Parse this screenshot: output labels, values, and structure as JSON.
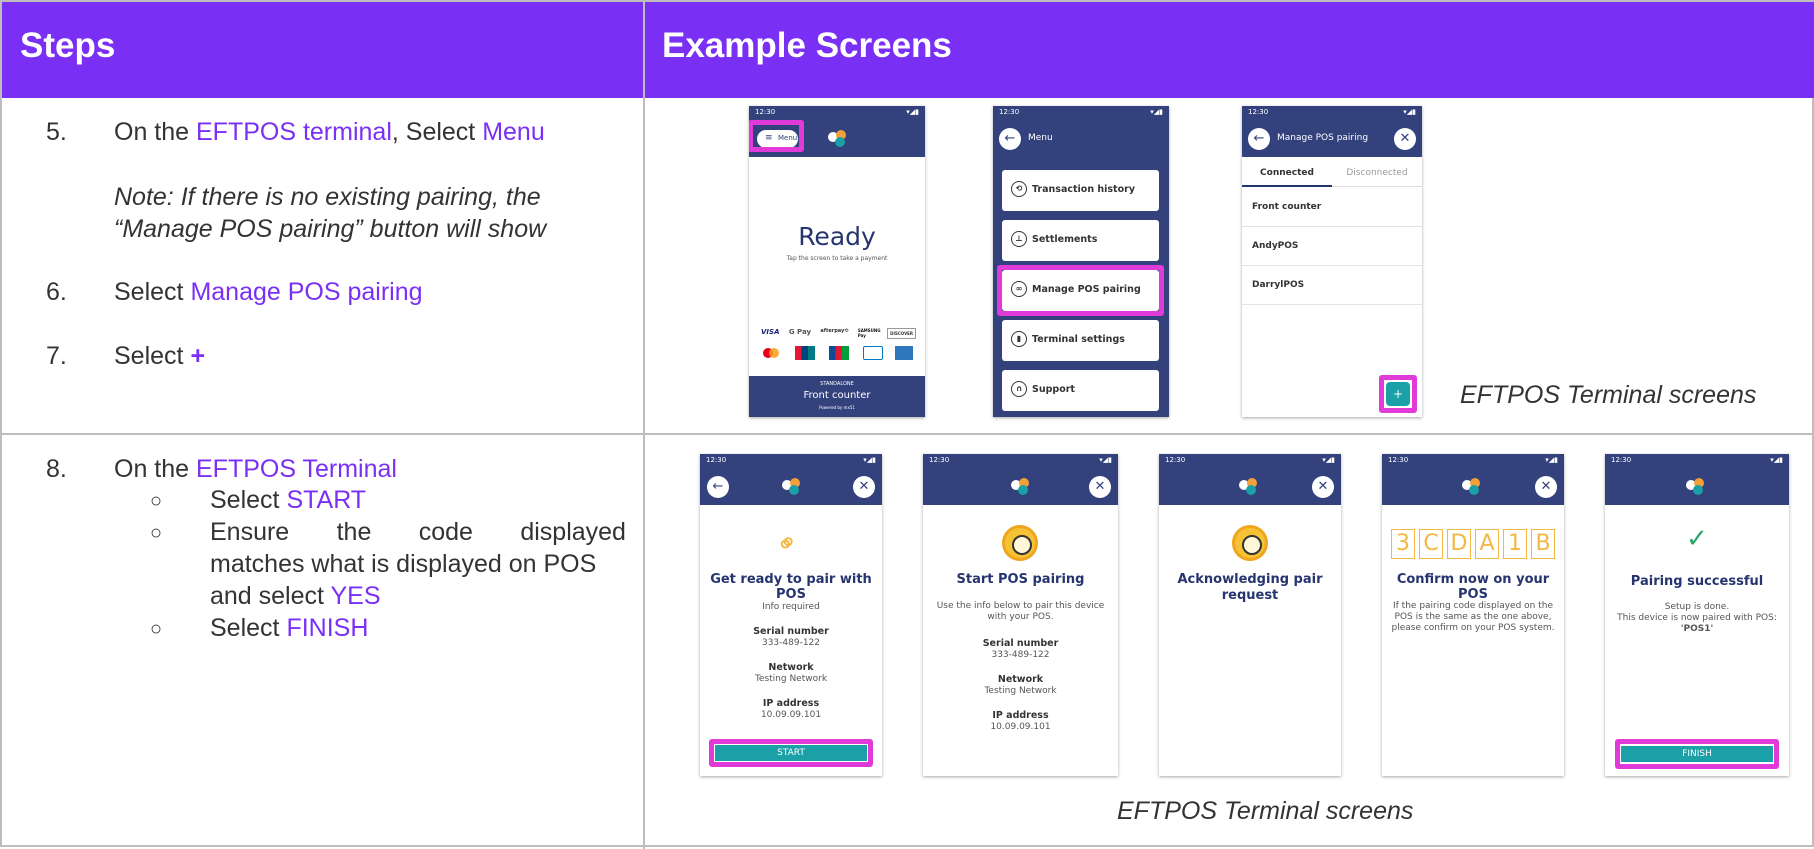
{
  "header": {
    "steps": "Steps",
    "examples": "Example Screens"
  },
  "row1": {
    "s5_num": "5.",
    "s5_pre": "On the ",
    "s5_term": "EFTPOS terminal",
    "s5_mid": ", Select ",
    "s5_menu": "Menu",
    "note1": "Note: If there is no existing pairing, the",
    "note2": "“Manage POS pairing” button will show",
    "s6_num": "6.",
    "s6_pre": "Select ",
    "s6_link": "Manage POS pairing",
    "s7_num": "7.",
    "s7_pre": "Select ",
    "s7_plus": "+",
    "caption": "EFTPOS Terminal screens"
  },
  "row2": {
    "s8_num": "8.",
    "s8_pre": "On the ",
    "s8_term": "EFTPOS Terminal",
    "b1_pre": "Select ",
    "b1_hl": "START",
    "b2_line1_a": "Ensure",
    "b2_line1_b": "the",
    "b2_line1_c": "code",
    "b2_line1_d": "displayed",
    "b2_line2": "matches what is displayed on POS",
    "b2_line3_pre": "and select ",
    "b2_line3_hl": "YES",
    "b3_pre": "Select ",
    "b3_hl": "FINISH",
    "caption": "EFTPOS Terminal screens",
    "bullet": "○"
  },
  "phones": {
    "time": "12:30",
    "status_icons": "▾◢▮",
    "p1": {
      "menu": "Menu",
      "ready": "Ready",
      "tap": "Tap the screen to take a payment",
      "pay1": "VISA",
      "pay2": "G Pay",
      "pay3": "afterpay⟲",
      "pay4": "SAMSUNG Pay",
      "pay5": "DISCOVER",
      "standalone": "STANDALONE",
      "counter": "Front counter",
      "powered": "Powered by mx51"
    },
    "p2": {
      "title": "Menu",
      "items": [
        "Transaction history",
        "Settlements",
        "Manage POS pairing",
        "Terminal settings",
        "Support"
      ]
    },
    "p3": {
      "title": "Manage POS pairing",
      "tab1": "Connected",
      "tab2": "Disconnected",
      "items": [
        "Front counter",
        "AndyPOS",
        "DarrylPOS"
      ],
      "plus": "+"
    },
    "q1": {
      "title": "Get ready to pair with POS",
      "info": "Info required",
      "serial_l": "Serial number",
      "serial_v": "333-489-122",
      "net_l": "Network",
      "net_v": "Testing Network",
      "ip_l": "IP address",
      "ip_v": "10.09.09.101",
      "btn": "START"
    },
    "q2": {
      "title": "Start POS pairing",
      "desc1": "Use the info below to pair this device",
      "desc2": "with your POS.",
      "serial_l": "Serial number",
      "serial_v": "333-489-122",
      "net_l": "Network",
      "net_v": "Testing Network",
      "ip_l": "IP address",
      "ip_v": "10.09.09.101"
    },
    "q3": {
      "title1": "Acknowledging pair",
      "title2": "request"
    },
    "q4": {
      "code": [
        "3",
        "C",
        "D",
        "A",
        "1",
        "B"
      ],
      "title": "Confirm now on your POS",
      "d1": "If the pairing code displayed on the",
      "d2": "POS is the same as the one above,",
      "d3": "please confirm on your POS system."
    },
    "q5": {
      "check": "✓",
      "title": "Pairing successful",
      "d1": "Setup is done.",
      "d2": "This device is now paired with POS:",
      "d3": "'POS1'",
      "btn": "FINISH"
    }
  },
  "colors": {
    "accent": "#7a2ff5",
    "highlight": "#e03bd8",
    "terminal": "#33427d",
    "teal": "#1aa0a6"
  }
}
